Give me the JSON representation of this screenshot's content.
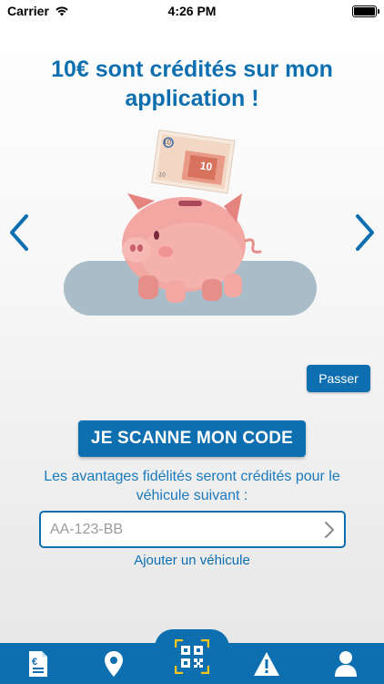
{
  "status_bar": {
    "carrier": "Carrier",
    "time": "4:26 PM"
  },
  "onboarding": {
    "headline": "10€ sont crédités sur mon application !",
    "skip_label": "Passer",
    "banknote_value": "10"
  },
  "scan": {
    "button_label": "JE SCANNE MON CODE",
    "info_text": "Les avantages fidélités seront crédités pour le véhicule suivant :",
    "plate_placeholder": "AA-123-BB",
    "add_vehicle_label": "Ajouter un véhicule"
  },
  "tab_bar": {
    "items": [
      {
        "icon": "euro-document-icon"
      },
      {
        "icon": "location-pin-icon"
      },
      {
        "icon": "qr-code-icon"
      },
      {
        "icon": "warning-icon"
      },
      {
        "icon": "user-icon"
      }
    ]
  },
  "colors": {
    "brand_blue": "#0d6fb0",
    "pig_pink": "#f3a7a3",
    "placeholder_gray": "#9b9b9b"
  }
}
